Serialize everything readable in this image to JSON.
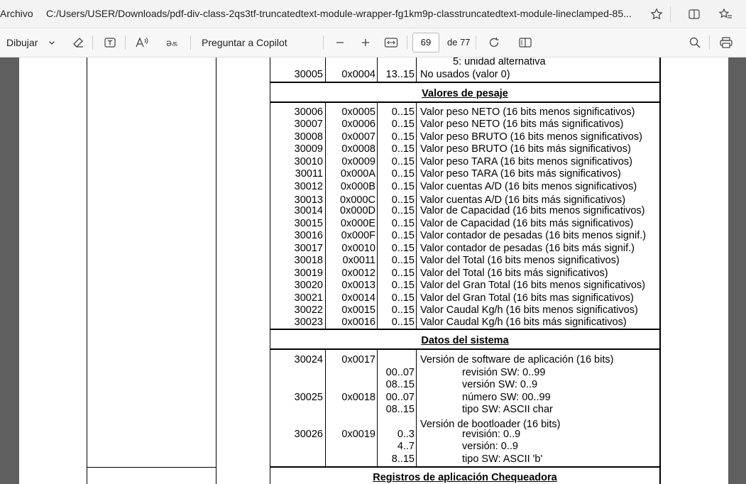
{
  "browser": {
    "left_label": "Archivo",
    "url": "C:/Users/USER/Downloads/pdf-div-class-2qs3tf-truncatedtext-module-wrapper-fg1km9p-classtruncatedtext-module-lineclamped-85..."
  },
  "toolbar": {
    "draw_label": "Dibujar",
    "copilot_label": "Preguntar a Copilot",
    "page_current": "69",
    "page_total": "de 77"
  },
  "document": {
    "top_fragment": {
      "continuation_text": "5: unidad alternativa",
      "row": {
        "reg": "30005",
        "addr": "0x0004",
        "bits": "13..15",
        "desc": "No usados (valor 0)"
      }
    },
    "sections": [
      {
        "title": "Valores de pesaje",
        "rows": [
          {
            "reg": "30006",
            "addr": "0x0005",
            "bits": "0..15",
            "desc": "Valor peso NETO (16 bits menos significativos)"
          },
          {
            "reg": "30007",
            "addr": "0x0006",
            "bits": "0..15",
            "desc": "Valor peso NETO (16 bits más significativos)"
          },
          {
            "reg": "30008",
            "addr": "0x0007",
            "bits": "0..15",
            "desc": "Valor peso BRUTO (16 bits menos significativos)"
          },
          {
            "reg": "30009",
            "addr": "0x0008",
            "bits": "0..15",
            "desc": "Valor peso BRUTO (16 bits más significativos)"
          },
          {
            "reg": "30010",
            "addr": "0x0009",
            "bits": "0..15",
            "desc": "Valor peso TARA (16 bits menos significativos)"
          },
          {
            "reg": "30011",
            "addr": "0x000A",
            "bits": "0..15",
            "desc": "Valor peso TARA (16 bits más significativos)"
          },
          {
            "reg": "30012",
            "addr": "0x000B",
            "bits": "0..15",
            "desc": "Valor cuentas A/D (16 bits menos significativos)"
          },
          {
            "reg": "30013",
            "addr": "0x000C",
            "bits": "0..15",
            "desc": "Valor cuentas A/D (16 bits más significativos)"
          },
          {
            "reg": "30014",
            "addr": "0x000D",
            "bits": "0..15",
            "desc": "Valor de Capacidad (16 bits menos significativos)"
          },
          {
            "reg": "30015",
            "addr": "0x000E",
            "bits": "0..15",
            "desc": "Valor de Capacidad (16 bits más significativos)"
          },
          {
            "reg": "30016",
            "addr": "0x000F",
            "bits": "0..15",
            "desc": "Valor contador de pesadas (16 bits menos signif.)"
          },
          {
            "reg": "30017",
            "addr": "0x0010",
            "bits": "0..15",
            "desc": "Valor contador de pesadas (16 bits más signif.)"
          },
          {
            "reg": "30018",
            "addr": "0x0011",
            "bits": "0..15",
            "desc": "Valor del Total (16 bits menos significativos)"
          },
          {
            "reg": "30019",
            "addr": "0x0012",
            "bits": "0..15",
            "desc": "Valor del Total (16 bits más significativos)"
          },
          {
            "reg": "30020",
            "addr": "0x0013",
            "bits": "0..15",
            "desc": "Valor del Gran Total (16 bits menos significativos)"
          },
          {
            "reg": "30021",
            "addr": "0x0014",
            "bits": "0..15",
            "desc": "Valor del Gran Total (16 bits mas significativos)"
          },
          {
            "reg": "30022",
            "addr": "0x0015",
            "bits": "0..15",
            "desc": "Valor Caudal Kg/h (16 bits menos significativos)"
          },
          {
            "reg": "30023",
            "addr": "0x0016",
            "bits": "0..15",
            "desc": "Valor Caudal Kg/h (16 bits más significativos)"
          }
        ]
      },
      {
        "title": "Datos del sistema",
        "lines": [
          {
            "reg": "30024",
            "addr": "0x0017",
            "bits": "",
            "desc": "Versión de software de aplicación (16 bits)"
          },
          {
            "reg": "",
            "addr": "",
            "bits": "00..07",
            "desc": "revisión SW: 0..99"
          },
          {
            "reg": "",
            "addr": "",
            "bits": "08..15",
            "desc": "versión SW:  0..9"
          },
          {
            "reg": "30025",
            "addr": "0x0018",
            "bits": "00..07",
            "desc": "número SW: 00..99"
          },
          {
            "reg": "",
            "addr": "",
            "bits": "08..15",
            "desc": "tipo SW: ASCII char"
          },
          {
            "reg": "",
            "addr": "",
            "bits": "",
            "desc": "Versión de bootloader (16 bits)"
          },
          {
            "reg": "30026",
            "addr": "0x0019",
            "bits": "0..3",
            "desc": "revisión: 0..9"
          },
          {
            "reg": "",
            "addr": "",
            "bits": "4..7",
            "desc": "versión: 0..9"
          },
          {
            "reg": "",
            "addr": "",
            "bits": "8..15",
            "desc": "tipo SW: ASCII 'b'"
          }
        ]
      },
      {
        "title": "Registros de aplicación Chequeadora"
      }
    ]
  }
}
